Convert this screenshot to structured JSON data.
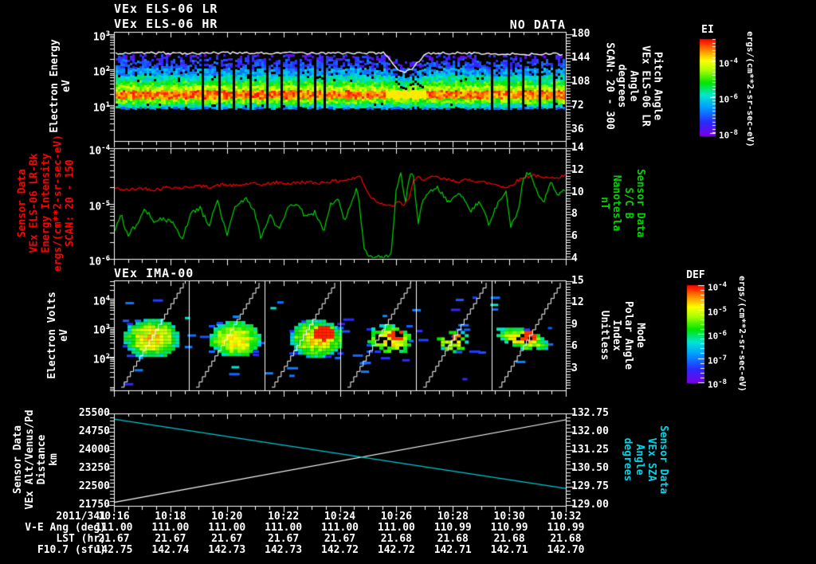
{
  "colors": {
    "background": "#000000",
    "frame": "#ffffff",
    "red": "#ff0000",
    "green": "#00d400",
    "cyan": "#00c8d4",
    "label_cyan": "#00d4e6",
    "white": "#ffffff",
    "rainbow": [
      "#7a00e6",
      "#2a2aff",
      "#00a0ff",
      "#00e6d2",
      "#00e600",
      "#aaff00",
      "#ffff00",
      "#ff9000",
      "#ff0000"
    ]
  },
  "time_axis": {
    "labels": [
      "10:16",
      "10:18",
      "10:20",
      "10:22",
      "10:24",
      "10:26",
      "10:28",
      "10:30",
      "10:32"
    ]
  },
  "chart_data": [
    {
      "type": "spectrogram",
      "title_lines": [
        "VEx ELS-06 LR",
        "VEx ELS-06 HR"
      ],
      "no_data_label": "NO DATA",
      "y_left": {
        "label_lines": [
          "Electron Energy",
          "eV"
        ],
        "color": "#ffffff",
        "scale": "log",
        "ticks": [
          "10^3",
          "10^2",
          "10^1"
        ],
        "tick_values": [
          3,
          2,
          1
        ]
      },
      "y_right": {
        "label_lines": [
          "Pitch Angle",
          "VEx ELS-06 LR",
          "Angle",
          "degrees",
          "SCAN: 20 - 300"
        ],
        "color": "#ffffff",
        "ticks": [
          "180",
          "144",
          "108",
          "72",
          "36"
        ],
        "tick_values": [
          180,
          144,
          108,
          72,
          36
        ]
      },
      "bands": [
        {
          "log_e": [
            2.32,
            2.46
          ],
          "v": 0.1,
          "dropout": 0.55
        },
        {
          "log_e": [
            2.06,
            2.32
          ],
          "v": 0.17,
          "dropout": 0.38
        },
        {
          "log_e": [
            1.86,
            2.06
          ],
          "v": 0.3,
          "dropout": 0.15
        },
        {
          "log_e": [
            1.7,
            1.86
          ],
          "v": 0.43,
          "dropout": 0.05
        },
        {
          "log_e": [
            1.56,
            1.7
          ],
          "v": 0.56,
          "dropout": 0
        },
        {
          "log_e": [
            1.44,
            1.56
          ],
          "v": 0.68,
          "dropout": 0
        },
        {
          "log_e": [
            1.2,
            1.44
          ],
          "v": 0.9,
          "dropout": 0
        },
        {
          "log_e": [
            1.08,
            1.2
          ],
          "v": 0.62,
          "dropout": 0
        },
        {
          "log_e": [
            0.96,
            1.08
          ],
          "v": 0.44,
          "dropout": 0.05
        },
        {
          "log_e": [
            0.9,
            0.96
          ],
          "v": 0.28,
          "dropout": 0.15
        }
      ],
      "white_line": {
        "log_e": 2.47,
        "dip": {
          "t_range": [
            0.6,
            0.688
          ],
          "min_log_e": 1.95
        }
      },
      "gaps_t": [
        0.194,
        0.229,
        0.265,
        0.3,
        0.335,
        0.37,
        0.406,
        0.441,
        0.464,
        0.836,
        0.871,
        0.905,
        0.938,
        0.972
      ]
    },
    {
      "type": "line",
      "y_left": {
        "label_lines": [
          "Sensor Data",
          "VEx ELS-06 LR-Bk",
          "Energy Intensity",
          "ergs/(cm**2-sr-sec-eV)",
          "SCAN: 20 - 150"
        ],
        "color": "#ff0000",
        "scale": "log",
        "ticks": [
          "10^-4",
          "10^-5",
          "10^-6"
        ],
        "tick_values": [
          -4,
          -5,
          -6
        ]
      },
      "y_right": {
        "label_lines": [
          "Sensor Data",
          "S/C B",
          "Nanotesla",
          "nT"
        ],
        "color": "#00d400",
        "ticks": [
          "14",
          "12",
          "10",
          "8",
          "6",
          "4"
        ],
        "tick_values": [
          14,
          12,
          10,
          8,
          6,
          4
        ]
      },
      "series": [
        {
          "name": "ELS-06 LR-Bk energy intensity",
          "color": "#ff0000",
          "axis": "left",
          "noise": 0.03,
          "points": [
            [
              0.0,
              -4.72
            ],
            [
              0.03,
              -4.76
            ],
            [
              0.06,
              -4.72
            ],
            [
              0.09,
              -4.75
            ],
            [
              0.12,
              -4.7
            ],
            [
              0.15,
              -4.72
            ],
            [
              0.18,
              -4.68
            ],
            [
              0.21,
              -4.7
            ],
            [
              0.24,
              -4.66
            ],
            [
              0.27,
              -4.68
            ],
            [
              0.3,
              -4.64
            ],
            [
              0.33,
              -4.66
            ],
            [
              0.36,
              -4.62
            ],
            [
              0.39,
              -4.64
            ],
            [
              0.42,
              -4.61
            ],
            [
              0.45,
              -4.63
            ],
            [
              0.48,
              -4.6
            ],
            [
              0.51,
              -4.58
            ],
            [
              0.53,
              -4.55
            ],
            [
              0.545,
              -4.5
            ],
            [
              0.555,
              -4.68
            ],
            [
              0.565,
              -4.85
            ],
            [
              0.58,
              -4.95
            ],
            [
              0.6,
              -5.02
            ],
            [
              0.615,
              -5.06
            ],
            [
              0.628,
              -4.97
            ],
            [
              0.64,
              -5.03
            ],
            [
              0.652,
              -4.92
            ],
            [
              0.662,
              -4.62
            ],
            [
              0.672,
              -4.53
            ],
            [
              0.69,
              -4.56
            ],
            [
              0.71,
              -4.52
            ],
            [
              0.73,
              -4.56
            ],
            [
              0.76,
              -4.6
            ],
            [
              0.79,
              -4.57
            ],
            [
              0.82,
              -4.62
            ],
            [
              0.85,
              -4.66
            ],
            [
              0.87,
              -4.72
            ],
            [
              0.89,
              -4.6
            ],
            [
              0.91,
              -4.52
            ],
            [
              0.93,
              -4.48
            ],
            [
              0.95,
              -4.55
            ],
            [
              0.97,
              -4.5
            ],
            [
              0.985,
              -4.56
            ],
            [
              1.0,
              -4.45
            ]
          ]
        },
        {
          "name": "S/C B magnetic field",
          "color": "#00d400",
          "axis": "right",
          "noise": 0.22,
          "points": [
            [
              0.0,
              6.3
            ],
            [
              0.015,
              8.2
            ],
            [
              0.03,
              6.1
            ],
            [
              0.05,
              7.1
            ],
            [
              0.07,
              8.5
            ],
            [
              0.09,
              7.2
            ],
            [
              0.11,
              7.7
            ],
            [
              0.13,
              7.2
            ],
            [
              0.15,
              5.7
            ],
            [
              0.17,
              8.1
            ],
            [
              0.19,
              8.6
            ],
            [
              0.21,
              7.0
            ],
            [
              0.23,
              9.2
            ],
            [
              0.25,
              6.1
            ],
            [
              0.27,
              8.8
            ],
            [
              0.29,
              9.5
            ],
            [
              0.31,
              8.5
            ],
            [
              0.325,
              5.9
            ],
            [
              0.345,
              7.9
            ],
            [
              0.365,
              6.7
            ],
            [
              0.385,
              8.7
            ],
            [
              0.405,
              9.1
            ],
            [
              0.425,
              7.7
            ],
            [
              0.445,
              8.2
            ],
            [
              0.465,
              6.6
            ],
            [
              0.48,
              8.9
            ],
            [
              0.495,
              9.5
            ],
            [
              0.51,
              7.2
            ],
            [
              0.525,
              9.0
            ],
            [
              0.537,
              10.4
            ],
            [
              0.545,
              8.3
            ],
            [
              0.553,
              5.0
            ],
            [
              0.562,
              4.3
            ],
            [
              0.58,
              4.1
            ],
            [
              0.6,
              4.15
            ],
            [
              0.614,
              4.5
            ],
            [
              0.625,
              10.4
            ],
            [
              0.635,
              11.7
            ],
            [
              0.645,
              9.2
            ],
            [
              0.653,
              11.2
            ],
            [
              0.662,
              11.9
            ],
            [
              0.673,
              7.0
            ],
            [
              0.684,
              9.4
            ],
            [
              0.695,
              10.1
            ],
            [
              0.715,
              10.5
            ],
            [
              0.74,
              9.1
            ],
            [
              0.765,
              9.9
            ],
            [
              0.79,
              8.4
            ],
            [
              0.81,
              9.1
            ],
            [
              0.83,
              7.1
            ],
            [
              0.85,
              9.1
            ],
            [
              0.868,
              10.1
            ],
            [
              0.878,
              6.9
            ],
            [
              0.893,
              8.1
            ],
            [
              0.907,
              11.4
            ],
            [
              0.92,
              11.8
            ],
            [
              0.932,
              10.3
            ],
            [
              0.95,
              9.1
            ],
            [
              0.968,
              11.1
            ],
            [
              0.98,
              9.6
            ],
            [
              1.0,
              10.4
            ]
          ]
        }
      ]
    },
    {
      "type": "spectrogram",
      "title": "VEx IMA-00",
      "y_left": {
        "label_lines": [
          "Electron Volts",
          "eV"
        ],
        "color": "#ffffff",
        "scale": "log",
        "ticks": [
          "10^4",
          "10^3",
          "10^2"
        ],
        "tick_values": [
          4,
          3,
          2
        ]
      },
      "y_right": {
        "label_lines": [
          "Mode",
          "Polar Angle",
          "Index",
          "Unitless"
        ],
        "color": "#ffffff",
        "ticks": [
          "15",
          "12",
          "9",
          "6",
          "3"
        ],
        "tick_values": [
          15,
          12,
          9,
          6,
          3
        ]
      },
      "segment_dividers_t": [
        0.1658,
        0.3333,
        0.5008,
        0.6684,
        0.8359
      ],
      "blobs": [
        {
          "t": 0.083,
          "log_ev": 2.62,
          "rx": 33,
          "ry": 23,
          "hot": 0.3,
          "sparse": 0,
          "tilt": 0
        },
        {
          "t": 0.268,
          "log_ev": 2.6,
          "rx": 30,
          "ry": 21,
          "hot": 0.35,
          "sparse": 0,
          "tilt": 0
        },
        {
          "t": 0.45,
          "log_ev": 2.62,
          "rx": 32,
          "ry": 22,
          "hot": 0.95,
          "sparse": 0,
          "tilt": 0
        },
        {
          "t": 0.612,
          "log_ev": 2.6,
          "rx": 27,
          "ry": 17,
          "hot": 0.9,
          "sparse": 0.25,
          "tilt": -0.1
        },
        {
          "t": 0.75,
          "log_ev": 2.56,
          "rx": 18,
          "ry": 14,
          "hot": 0.5,
          "sparse": 0.45,
          "tilt": 0
        },
        {
          "t": 0.903,
          "log_ev": 2.62,
          "rx": 30,
          "ry": 12,
          "hot": 0.85,
          "sparse": 0.1,
          "tilt": -0.25
        }
      ],
      "dash_count": 55
    },
    {
      "type": "line",
      "y_left": {
        "label_lines": [
          "Sensor Data",
          "VEx Alt/Venus/Pd",
          "Distance",
          "km"
        ],
        "color": "#ffffff",
        "ticks": [
          "25500",
          "24750",
          "24000",
          "23250",
          "22500",
          "21750"
        ],
        "tick_values": [
          25500,
          24750,
          24000,
          23250,
          22500,
          21750
        ]
      },
      "y_right": {
        "label_lines": [
          "Sensor Data",
          "VEx SZA",
          "Angle",
          "degrees"
        ],
        "color": "#00d4e6",
        "ticks": [
          "132.75",
          "132.00",
          "131.25",
          "130.50",
          "129.75",
          "129.00"
        ],
        "tick_values": [
          132.75,
          132.0,
          131.25,
          130.5,
          129.75,
          129.0
        ]
      },
      "series": [
        {
          "name": "VEx altitude",
          "color": "#ffffff",
          "axis": "left",
          "points": [
            [
              0,
              21860
            ],
            [
              1,
              25240
            ]
          ]
        },
        {
          "name": "VEx solar zenith angle",
          "color": "#00c8d4",
          "axis": "right",
          "points": [
            [
              0,
              132.52
            ],
            [
              1,
              129.68
            ]
          ]
        }
      ]
    }
  ],
  "colorbars": [
    {
      "title": "EI",
      "unit": "ergs/(cm**2-sr-sec-eV)",
      "ticks": [
        "10^-4",
        "10^-6",
        "10^-8"
      ],
      "tick_values": [
        -4,
        -6,
        -8
      ]
    },
    {
      "title": "DEF",
      "unit": "ergs/(cm**2-sr-sec-eV)",
      "ticks": [
        "10^-4",
        "10^-5",
        "10^-6",
        "10^-7",
        "10^-8"
      ],
      "tick_values": [
        -4,
        -5,
        -6,
        -7,
        -8
      ]
    }
  ],
  "table": {
    "date_label": "2011/341",
    "rows": [
      {
        "label": "V-E Ang (deg)",
        "values": [
          "111.00",
          "111.00",
          "111.00",
          "111.00",
          "111.00",
          "111.00",
          "110.99",
          "110.99",
          "110.99"
        ]
      },
      {
        "label": "LST (hr)",
        "values": [
          "21.67",
          "21.67",
          "21.67",
          "21.67",
          "21.67",
          "21.68",
          "21.68",
          "21.68",
          "21.68"
        ]
      },
      {
        "label": "F10.7 (sfu)",
        "values": [
          "142.75",
          "142.74",
          "142.73",
          "142.73",
          "142.72",
          "142.72",
          "142.71",
          "142.71",
          "142.70"
        ]
      }
    ]
  }
}
